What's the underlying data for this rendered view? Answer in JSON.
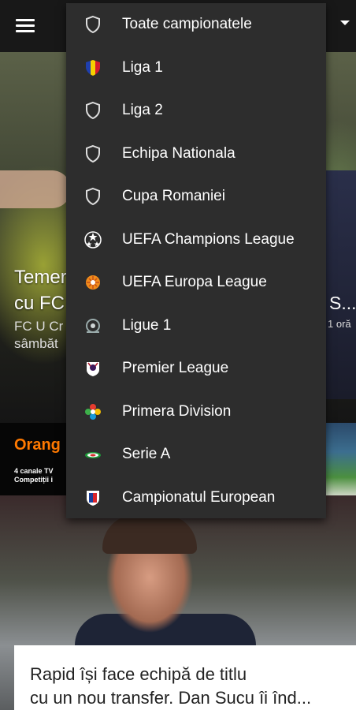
{
  "menu": {
    "items": [
      {
        "label": "Toate campionatele",
        "icon": "shield-outline-icon"
      },
      {
        "label": "Liga 1",
        "icon": "romania-flag-icon"
      },
      {
        "label": "Liga 2",
        "icon": "shield-outline-icon"
      },
      {
        "label": "Echipa Nationala",
        "icon": "shield-outline-icon"
      },
      {
        "label": "Cupa Romaniei",
        "icon": "shield-outline-icon"
      },
      {
        "label": "UEFA Champions League",
        "icon": "champions-league-icon"
      },
      {
        "label": "UEFA Europa League",
        "icon": "europa-league-icon"
      },
      {
        "label": "Ligue 1",
        "icon": "ligue1-icon"
      },
      {
        "label": "Premier League",
        "icon": "premier-league-icon"
      },
      {
        "label": "Primera Division",
        "icon": "laliga-icon"
      },
      {
        "label": "Serie A",
        "icon": "serie-a-icon"
      },
      {
        "label": "Campionatul European",
        "icon": "euro-championship-icon"
      }
    ]
  },
  "hero": {
    "title_line1": "Temer",
    "title_line2": "cu FC",
    "subtitle_line1": "FC U Cr",
    "subtitle_line2": "sâmbăt",
    "side_title": "S...",
    "side_time": "1 oră"
  },
  "ad": {
    "brand": "Orang",
    "line1": "4 canale TV",
    "line2": "Competiții i"
  },
  "article2": {
    "title_line1": "Rapid își face echipă de titlu",
    "title_line2": "cu un nou transfer. Dan Sucu îi înd..."
  },
  "colors": {
    "topbar": "#181818",
    "menu_bg": "#2d2d2d",
    "ad_brand": "#ff7900"
  }
}
